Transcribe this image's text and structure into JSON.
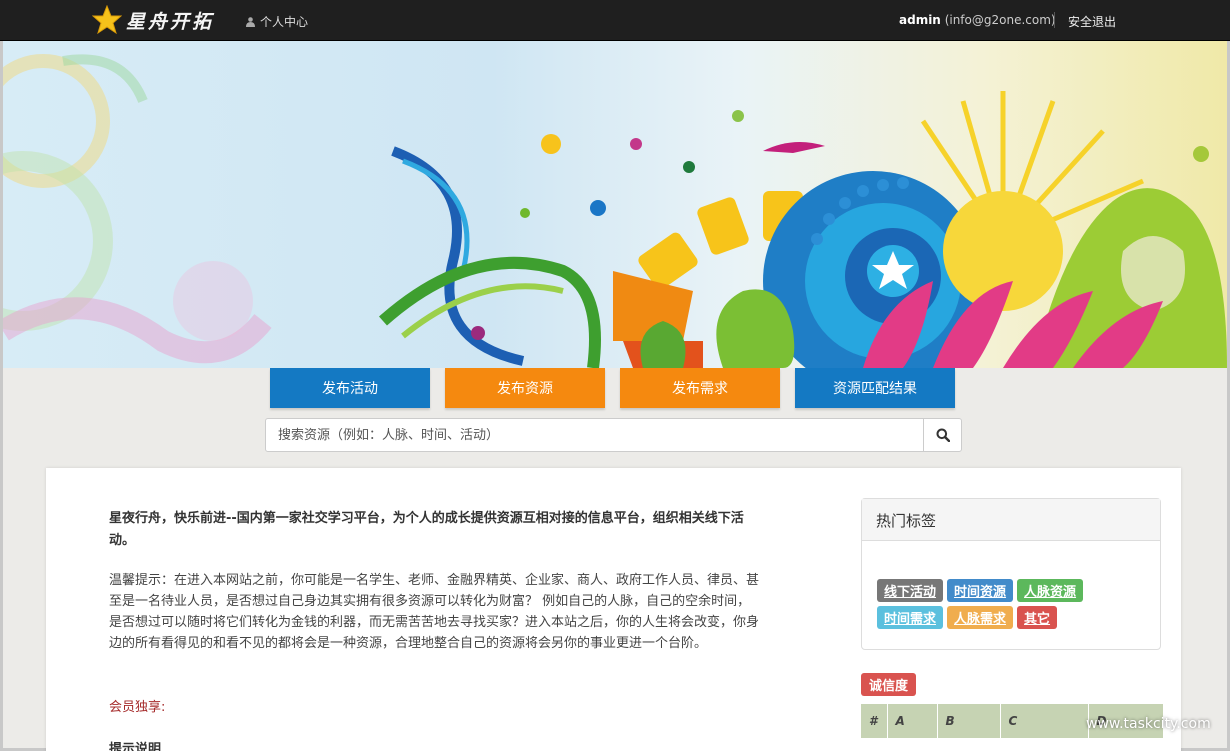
{
  "header": {
    "logo_text": "星舟开拓",
    "user_center_label": "个人中心",
    "account_name": "admin",
    "account_email": "(info@g2one.com)",
    "logout_label": "安全退出"
  },
  "actions": {
    "publish_activity": "发布活动",
    "publish_resource": "发布资源",
    "publish_demand": "发布需求",
    "match_result": "资源匹配结果"
  },
  "search": {
    "placeholder": "搜索资源（例如：人脉、时间、活动）"
  },
  "main": {
    "intro": "星夜行舟，快乐前进--国内第一家社交学习平台，为个人的成长提供资源互相对接的信息平台，组织相关线下活动。",
    "tip": "温馨提示：在进入本网站之前，你可能是一名学生、老师、金融界精英、企业家、商人、政府工作人员、律员、甚至是一名待业人员，是否想过自己身边其实拥有很多资源可以转化为财富？ 例如自己的人脉，自己的空余时间，是否想过可以随时将它们转化为金钱的利器，而无需苦苦地去寻找买家？进入本站之后，你的人生将会改变，你身边的所有看得见的和看不见的都将会是一种资源，合理地整合自己的资源将会另你的事业更进一个台阶。",
    "member_label": "会员独享:",
    "sub_label": "提示说明"
  },
  "hot_tags": {
    "title": "热门标签",
    "tags": [
      {
        "label": "线下活动",
        "color": "#777777"
      },
      {
        "label": "时间资源",
        "color": "#428bca"
      },
      {
        "label": "人脉资源",
        "color": "#5cb85c"
      },
      {
        "label": "时间需求",
        "color": "#5bc0de"
      },
      {
        "label": "人脉需求",
        "color": "#f0ad4e"
      },
      {
        "label": "其它",
        "color": "#d9534f"
      }
    ]
  },
  "credibility": {
    "label": "诚信度",
    "columns": [
      "#",
      "A",
      "B",
      "C",
      "D"
    ]
  },
  "watermark": "www.taskcity.com",
  "colors": {
    "topbar": "#1f1f1f",
    "button_blue": "#1479c3",
    "button_orange": "#f5890f",
    "accent_red": "#d9534f"
  }
}
